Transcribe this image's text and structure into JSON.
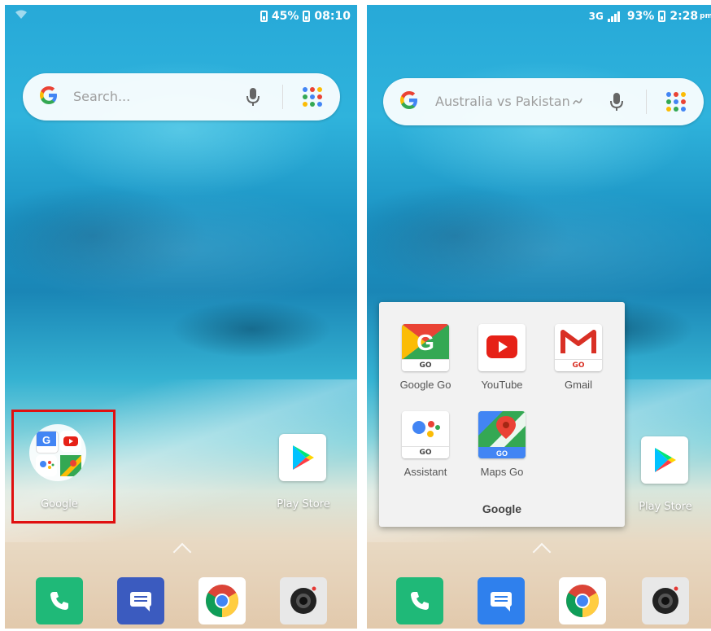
{
  "left_screen": {
    "status": {
      "battery": "45%",
      "time": "08:10"
    },
    "search": {
      "placeholder": "Search..."
    },
    "folder": {
      "label": "Google"
    },
    "play_store": {
      "label": "Play Store"
    }
  },
  "right_screen": {
    "status": {
      "network": "3G",
      "battery": "93%",
      "time": "2:28",
      "ampm": "pm"
    },
    "search": {
      "query": "Australia vs Pakistan"
    },
    "folder_panel": {
      "title": "Google",
      "apps": [
        {
          "label": "Google Go",
          "icon": "google-go-icon"
        },
        {
          "label": "YouTube",
          "icon": "youtube-icon"
        },
        {
          "label": "Gmail",
          "icon": "gmail-icon"
        },
        {
          "label": "Assistant",
          "icon": "assistant-icon"
        },
        {
          "label": "Maps Go",
          "icon": "maps-go-icon"
        }
      ]
    },
    "play_store": {
      "label": "Play Store"
    }
  },
  "dock": [
    "phone-icon",
    "messages-icon",
    "chrome-icon",
    "camera-icon"
  ],
  "go_badge": "GO",
  "colors": {
    "highlight": "#e01010",
    "google_blue": "#4285F4",
    "google_red": "#EA4335",
    "google_yellow": "#FBBC05",
    "google_green": "#34A853"
  }
}
